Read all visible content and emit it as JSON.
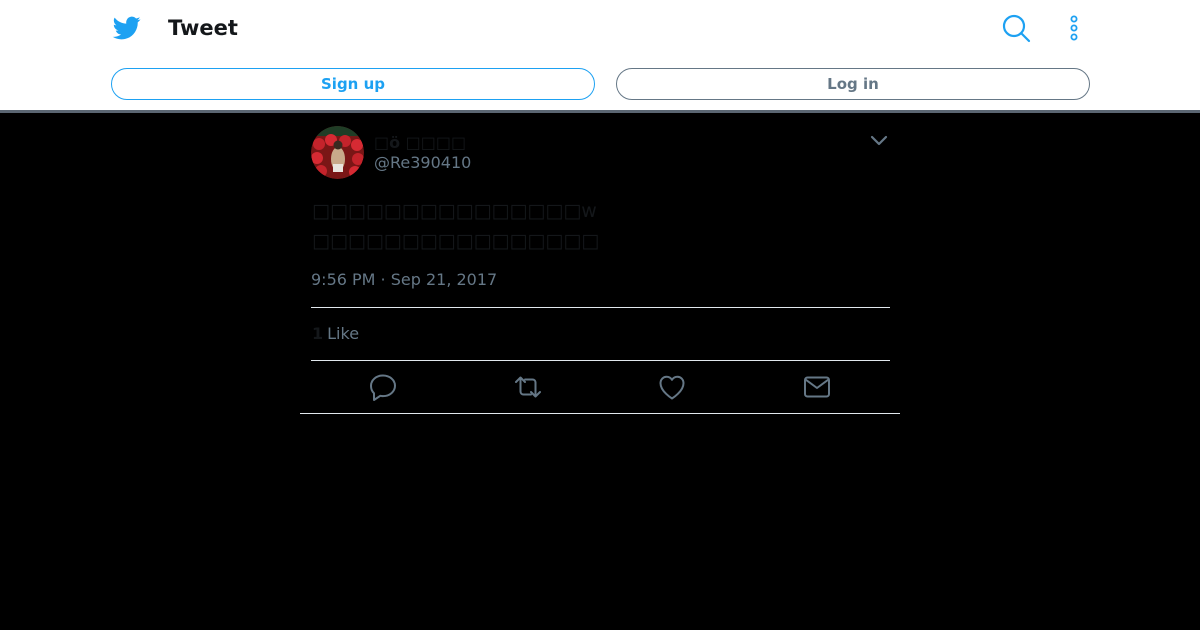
{
  "header": {
    "title": "Tweet",
    "sign_up_label": "Sign up",
    "log_in_label": "Log in",
    "icons": [
      "twitter-bird-icon",
      "search-icon",
      "more-vertical-icon"
    ]
  },
  "tweet": {
    "author_display_name": "□ö □□□□",
    "author_handle": "@Re390410",
    "text": "□□□□□□□□□□□□□□□w\n□□□□□□□□□□□□□□□□",
    "timestamp": "9:56 PM · Sep 21, 2017",
    "like_count": "1",
    "like_label": "Like"
  },
  "actions": [
    "reply-icon",
    "retweet-icon",
    "like-icon",
    "direct-message-icon"
  ],
  "colors": {
    "brand": "#1da1f2",
    "secondary_text": "#657786",
    "page_background": "#000000"
  }
}
